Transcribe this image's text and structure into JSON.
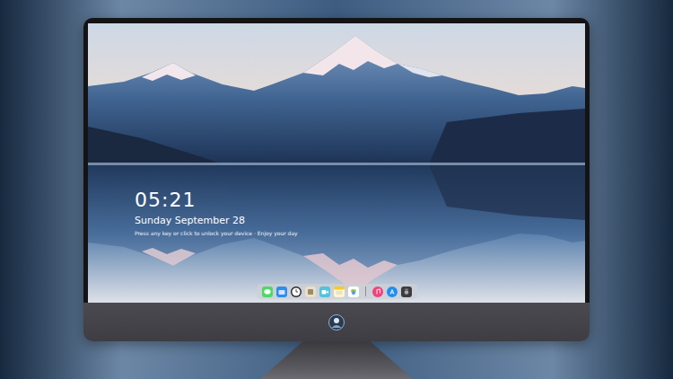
{
  "lock_screen": {
    "time": "05:21",
    "date": "Sunday September 28",
    "hint": "Press any key or click to unlock your device · Enjoy your day"
  }
}
